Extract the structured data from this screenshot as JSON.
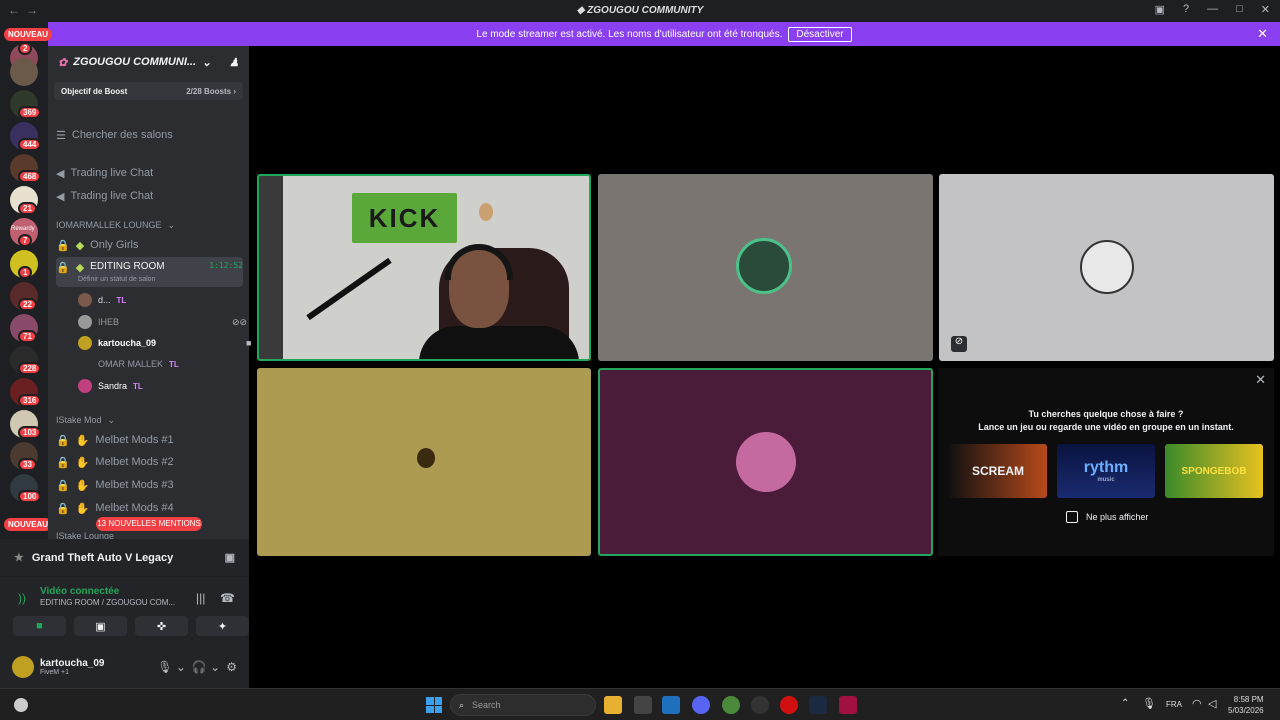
{
  "window": {
    "title": "ZGOUGOU COMMUNITY"
  },
  "banner": {
    "text": "Le mode streamer est activé. Les noms d'utilisateur ont été tronqués.",
    "button": "Désactiver"
  },
  "server_rail": {
    "new_top": "NOUVEAU",
    "new_bottom": "NOUVEAU",
    "badges": [
      "2",
      "369",
      "444",
      "468",
      "21",
      "7",
      "1",
      "22",
      "71",
      "228",
      "316",
      "103",
      "33",
      "100"
    ],
    "reward_label": "Rewardy"
  },
  "sidebar": {
    "server_name": "ZGOUGOU COMMUNI...",
    "boost_label": "Objectif de Boost",
    "boost_count": "2/28 Boosts",
    "search_channels": "Chercher des salons",
    "channels_top": [
      "Trading live Chat",
      "Trading live Chat"
    ],
    "category1": "IOMARMALLEK LOUNGE",
    "only_girls": "Only Girls",
    "editing_room": "EDITING ROOM",
    "editing_timer": "1:12:52",
    "status_hint": "Définir un statut de salon",
    "voice_users": [
      {
        "name": "d...",
        "tag": "TL"
      },
      {
        "name": "IHEB",
        "tag": ""
      },
      {
        "name": "kartoucha_09",
        "tag": ""
      },
      {
        "name": "OMAR MALLEK",
        "tag": "TL"
      },
      {
        "name": "Sandra",
        "tag": "TL"
      }
    ],
    "category2": "IStake Mod",
    "mod_channels": [
      "Melbet Mods #1",
      "Melbet Mods #2",
      "Melbet Mods #3",
      "Melbet Mods #4"
    ],
    "mentions": "13 NOUVELLES MENTIONS",
    "category3": "IStake Lounge"
  },
  "panel": {
    "game": "Grand Theft Auto V Legacy",
    "voice_connected": "Vidéo connectée",
    "voice_location": "EDITING ROOM / ZGOUGOU COM...",
    "username": "kartoucha_09",
    "user_status": "FiveM +1"
  },
  "stage": {
    "kick_sign": "KICK"
  },
  "suggestion": {
    "title": "Tu cherches quelque chose à faire ?",
    "subtitle": "Lance un jeu ou regarde une vidéo en groupe en un instant.",
    "thumbs": [
      "SCREAM",
      "rythm",
      "SPONGEBOB"
    ],
    "thumb_sub": "music",
    "checkbox_label": "Ne plus afficher"
  },
  "taskbar": {
    "search_placeholder": "Search",
    "lang": "FRA",
    "time": "8:58 PM",
    "date": "5/03/2026"
  },
  "colors": {
    "accent": "#8a3ff0",
    "green": "#23a55a",
    "red": "#f23f43"
  }
}
